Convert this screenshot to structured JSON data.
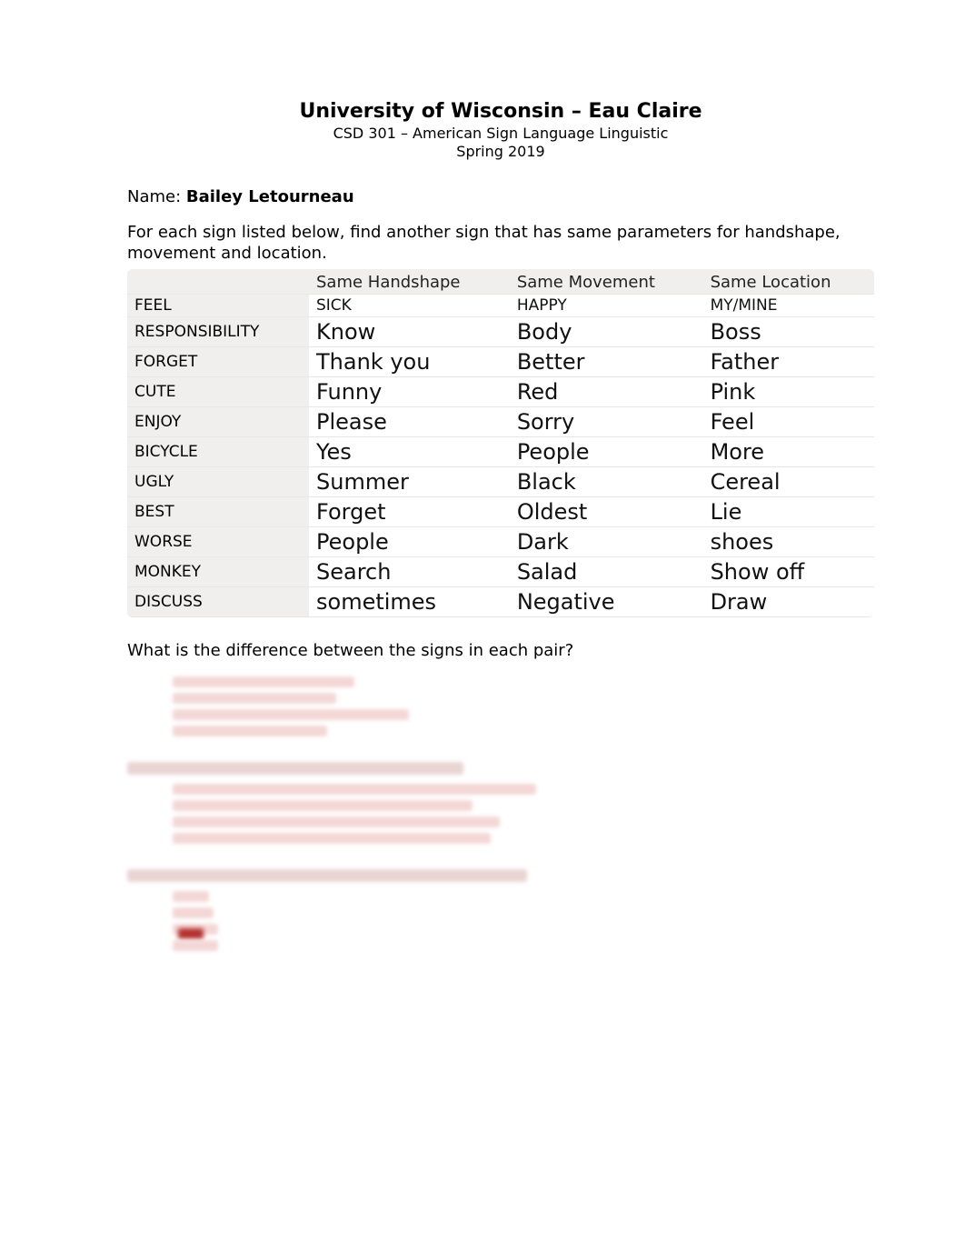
{
  "header": {
    "title": "University of Wisconsin – Eau Claire",
    "course": "CSD 301 – American Sign Language Linguistic",
    "term": "Spring 2019"
  },
  "name": {
    "label": "Name: ",
    "value": "Bailey Letourneau"
  },
  "instructions": "For each sign listed below, find another sign that has same parameters for handshape, movement and location.",
  "table": {
    "headers": [
      "",
      "Same Handshape",
      "Same Movement",
      "Same Location"
    ],
    "rows": [
      {
        "sign": "FEEL",
        "handshape": "SICK",
        "movement": "HAPPY",
        "location": "MY/MINE"
      },
      {
        "sign": "RESPONSIBILITY",
        "handshape": "Know",
        "movement": "Body",
        "location": "Boss"
      },
      {
        "sign": "FORGET",
        "handshape": "Thank you",
        "movement": "Better",
        "location": "Father"
      },
      {
        "sign": "CUTE",
        "handshape": "Funny",
        "movement": "Red",
        "location": "Pink"
      },
      {
        "sign": "ENJOY",
        "handshape": "Please",
        "movement": "Sorry",
        "location": "Feel"
      },
      {
        "sign": "BICYCLE",
        "handshape": "Yes",
        "movement": "People",
        "location": "More"
      },
      {
        "sign": "UGLY",
        "handshape": "Summer",
        "movement": "Black",
        "location": "Cereal"
      },
      {
        "sign": "BEST",
        "handshape": "Forget",
        "movement": "Oldest",
        "location": "Lie"
      },
      {
        "sign": "WORSE",
        "handshape": "People",
        "movement": "Dark",
        "location": "shoes"
      },
      {
        "sign": "MONKEY",
        "handshape": "Search",
        "movement": "Salad",
        "location": "Show off"
      },
      {
        "sign": "DISCUSS",
        "handshape": "sometimes",
        "movement": "Negative",
        "location": "Draw"
      }
    ]
  },
  "question2": "What is the difference between the signs in each pair?"
}
